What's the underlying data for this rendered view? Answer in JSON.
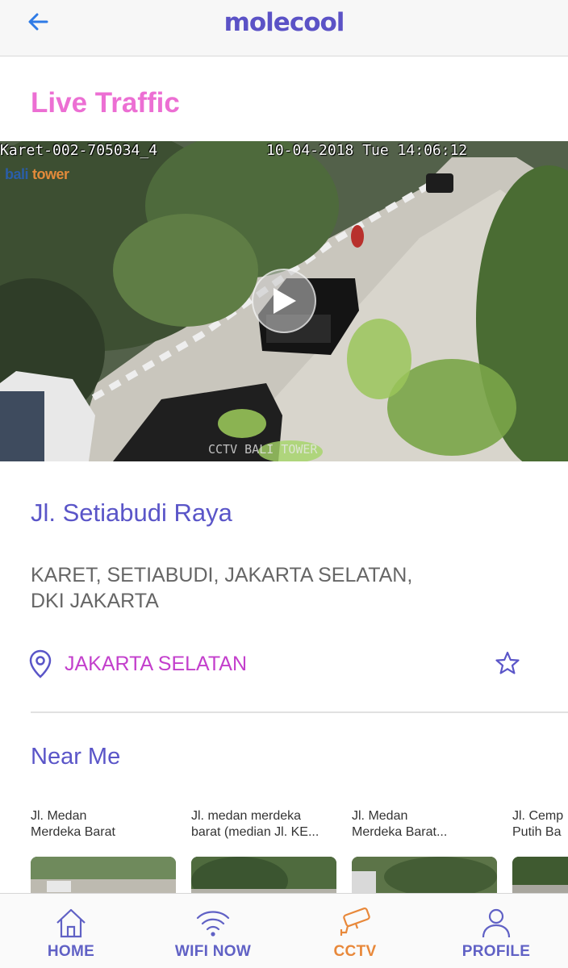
{
  "header": {
    "logo_text": "molecool",
    "back_icon": "arrow-left-icon",
    "brand_color": "#5b52c6"
  },
  "live_traffic": {
    "title": "Live Traffic",
    "video": {
      "camera_id": "Karet-002-705034_4",
      "timestamp": "10-04-2018 Tue 14:06:12",
      "brand_overlay": "balitower",
      "bottom_overlay": "CCTV BALI TOWER",
      "play_icon": "play-icon"
    }
  },
  "location": {
    "road_name": "Jl. Setiabudi Raya",
    "address": "KARET, SETIABUDI, JAKARTA SELATAN, DKI JAKARTA",
    "region": "JAKARTA SELATAN",
    "pin_icon": "map-pin-icon",
    "favorite_icon": "star-outline-icon"
  },
  "near_me": {
    "title": "Near Me",
    "items": [
      {
        "label": "Jl. Medan\nMerdeka Barat"
      },
      {
        "label": "Jl. medan merdeka\nbarat (median Jl. KE..."
      },
      {
        "label": "Jl. Medan\nMerdeka Barat..."
      },
      {
        "label": "Jl. Cemp\nPutih Ba"
      }
    ]
  },
  "tabbar": {
    "tabs": [
      {
        "label": "HOME",
        "icon": "home-icon"
      },
      {
        "label": "WIFI NOW",
        "icon": "wifi-icon"
      },
      {
        "label": "CCTV",
        "icon": "cctv-camera-icon",
        "active": true
      },
      {
        "label": "PROFILE",
        "icon": "user-icon"
      }
    ],
    "active_color": "#e8883a",
    "inactive_color": "#6061c5"
  }
}
